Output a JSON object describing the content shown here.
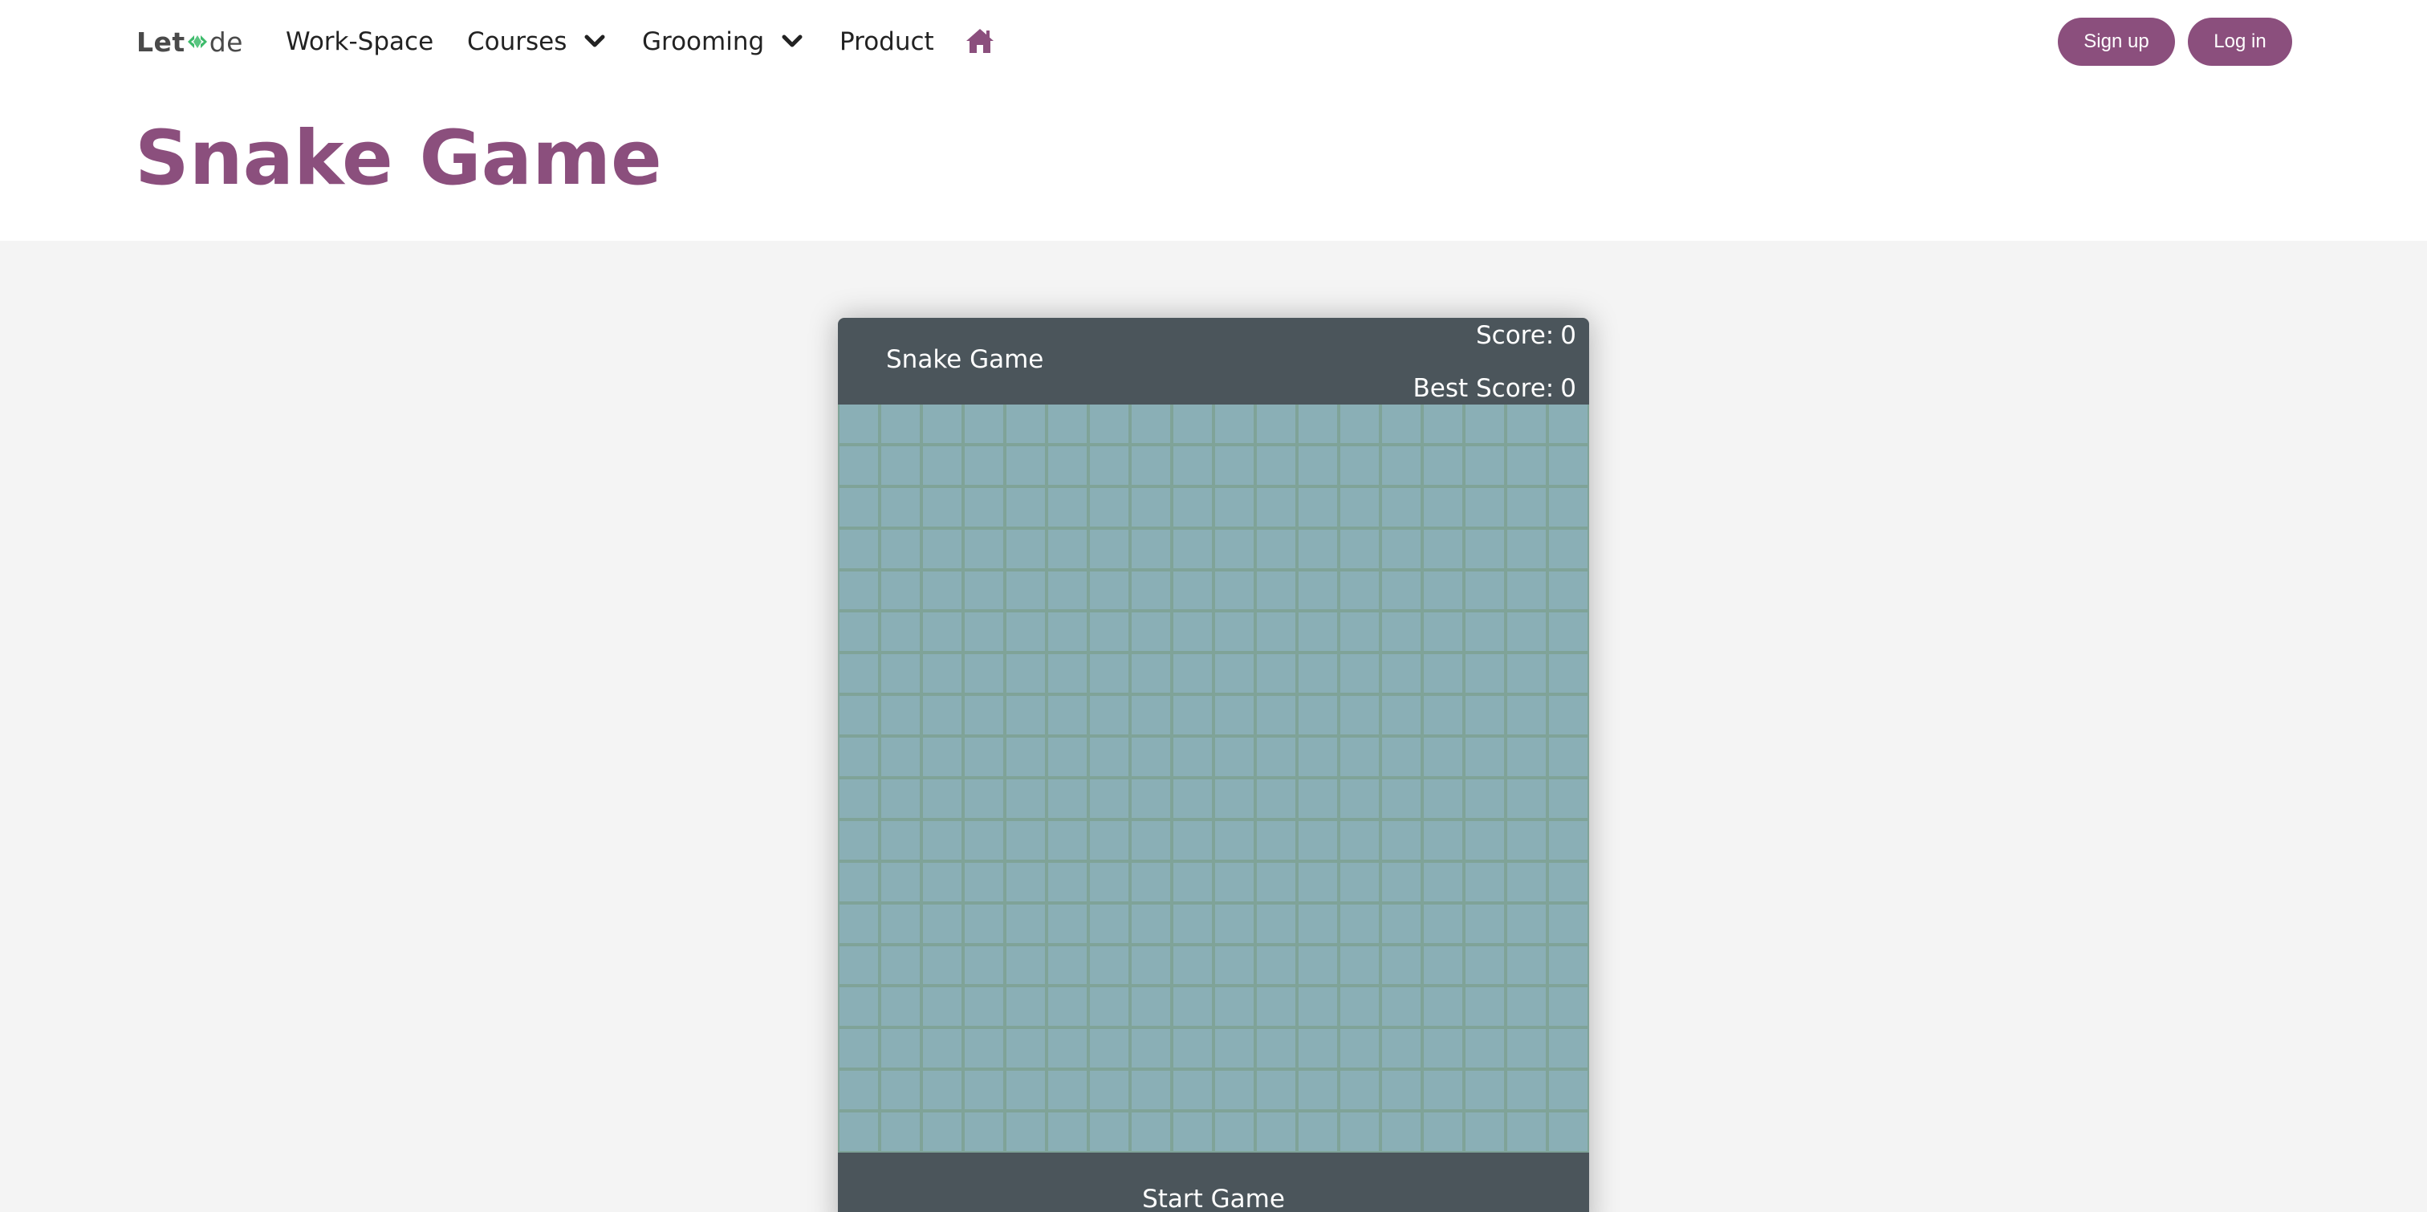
{
  "nav": {
    "logo_left": "Let",
    "logo_right": "de",
    "items": [
      {
        "label": "Work-Space",
        "has_dropdown": false
      },
      {
        "label": "Courses",
        "has_dropdown": true
      },
      {
        "label": "Grooming",
        "has_dropdown": true
      },
      {
        "label": "Product",
        "has_dropdown": false
      }
    ],
    "home_icon": "home-icon",
    "signup_label": "Sign up",
    "login_label": "Log in"
  },
  "page": {
    "title": "Snake Game"
  },
  "game": {
    "name": "Snake Game",
    "score_label": "Score:",
    "score_value": "0",
    "best_label": "Best Score:",
    "best_value": "0",
    "grid_cols": 18,
    "grid_rows": 18,
    "start_label": "Start Game"
  },
  "colors": {
    "brand": "#8b4f7d",
    "logo_accent": "#3dbb6b",
    "game_panel": "#4b555b",
    "board_cell": "#8aafb6",
    "board_grid": "#7fa398",
    "page_bg": "#f4f4f4"
  }
}
